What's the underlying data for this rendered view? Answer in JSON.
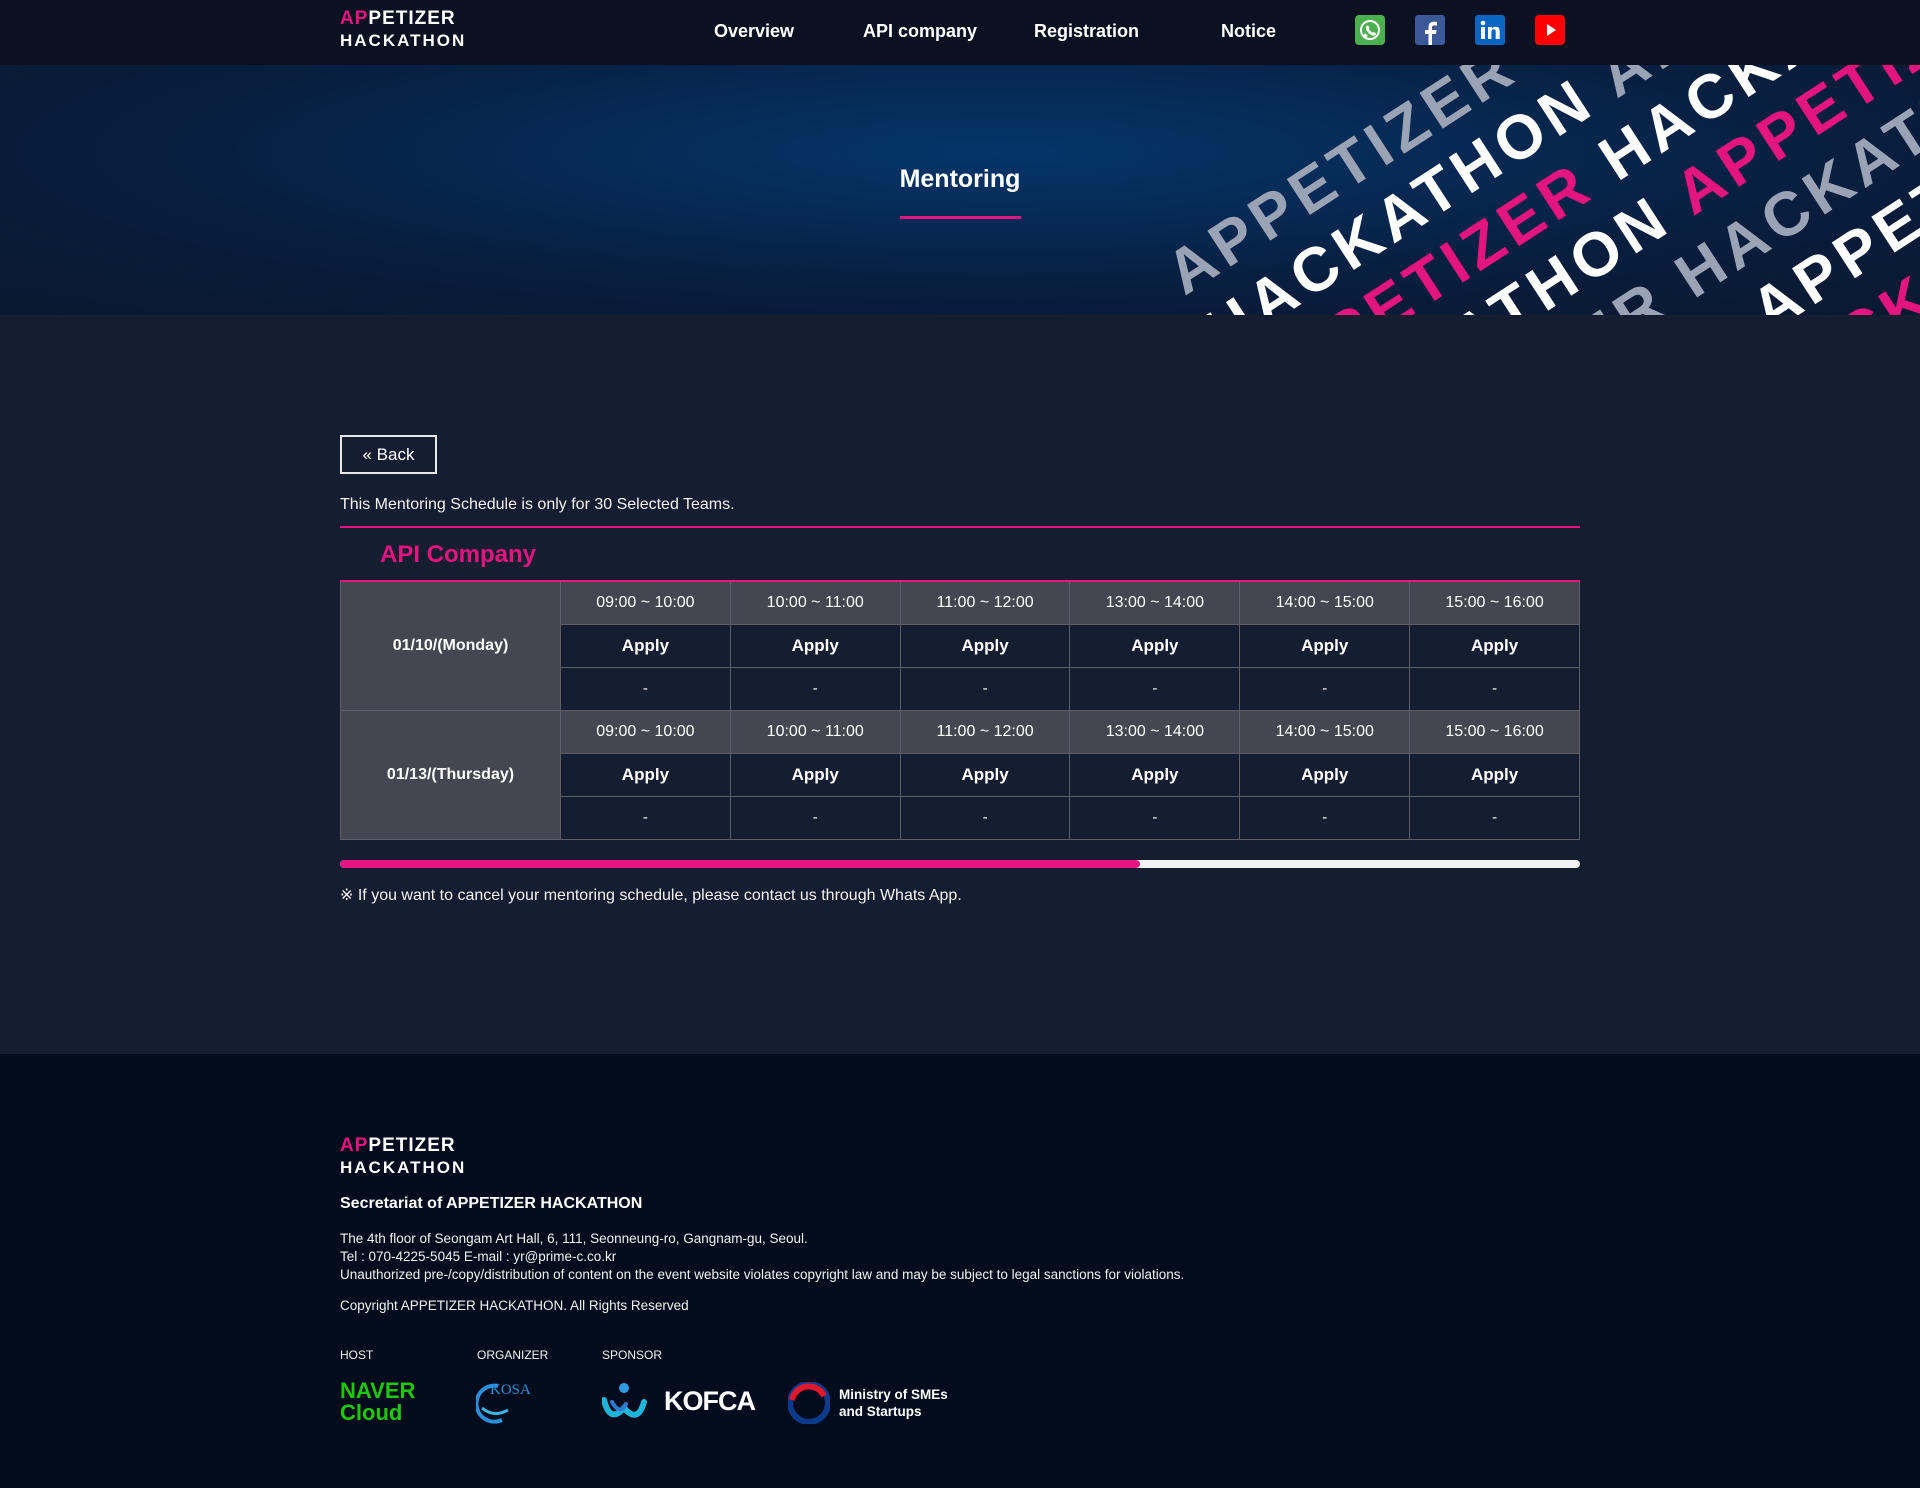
{
  "header": {
    "logo_line1_pink": "AP",
    "logo_line1_white": "PETIZER",
    "logo_line2": "HACKATHON",
    "nav": [
      "Overview",
      "API company",
      "Registration",
      "Notice"
    ],
    "social_icons": [
      "whatsapp-icon",
      "facebook-icon",
      "linkedin-icon",
      "youtube-icon"
    ]
  },
  "hero": {
    "title": "Mentoring",
    "art_words": [
      "APPETIZER",
      "HACKATHON"
    ]
  },
  "main": {
    "back_label": "« Back",
    "notice": "This Mentoring Schedule is only for 30 Selected Teams.",
    "company": "API Company",
    "schedule": [
      {
        "date": "01/10/(Monday)",
        "slots": [
          "09:00 ~ 10:00",
          "10:00 ~ 11:00",
          "11:00 ~ 12:00",
          "13:00 ~ 14:00",
          "14:00 ~ 15:00",
          "15:00 ~ 16:00"
        ],
        "apply_label": "Apply",
        "status": [
          "-",
          "-",
          "-",
          "-",
          "-",
          "-"
        ]
      },
      {
        "date": "01/13/(Thursday)",
        "slots": [
          "09:00 ~ 10:00",
          "10:00 ~ 11:00",
          "11:00 ~ 12:00",
          "13:00 ~ 14:00",
          "14:00 ~ 15:00",
          "15:00 ~ 16:00"
        ],
        "apply_label": "Apply",
        "status": [
          "-",
          "-",
          "-",
          "-",
          "-",
          "-"
        ]
      }
    ],
    "progress": 0.645,
    "cancel_note": "※ If you want to cancel your mentoring schedule, please contact us through Whats App."
  },
  "footer": {
    "secretariat": "Secretariat of APPETIZER HACKATHON",
    "address": "The 4th floor of Seongam Art Hall, 6, 111, Seonneung-ro, Gangnam-gu, Seoul.",
    "contact": "Tel : 070-4225-5045 E-mail : yr@prime-c.co.kr",
    "warning": "Unauthorized pre-/copy/distribution of content on the event website violates copyright law and may be subject to legal sanctions for violations.",
    "copyright": "Copyright APPETIZER HACKATHON. All Rights Reserved",
    "labels": {
      "host": "HOST",
      "organizer": "ORGANIZER",
      "sponsor": "SPONSOR"
    },
    "host_logo": {
      "line1": "NAVER",
      "line2": "Cloud"
    },
    "organizer_logo": "KOSA",
    "sponsor_logo": "KOFCA",
    "ministry_logo": {
      "line1": "Ministry of SMEs",
      "line2": "and Startups"
    }
  },
  "colors": {
    "accent": "#e4157f",
    "background": "#151d30",
    "header": "#0a1221",
    "footer": "#020c1c",
    "table_header": "#45464f"
  }
}
